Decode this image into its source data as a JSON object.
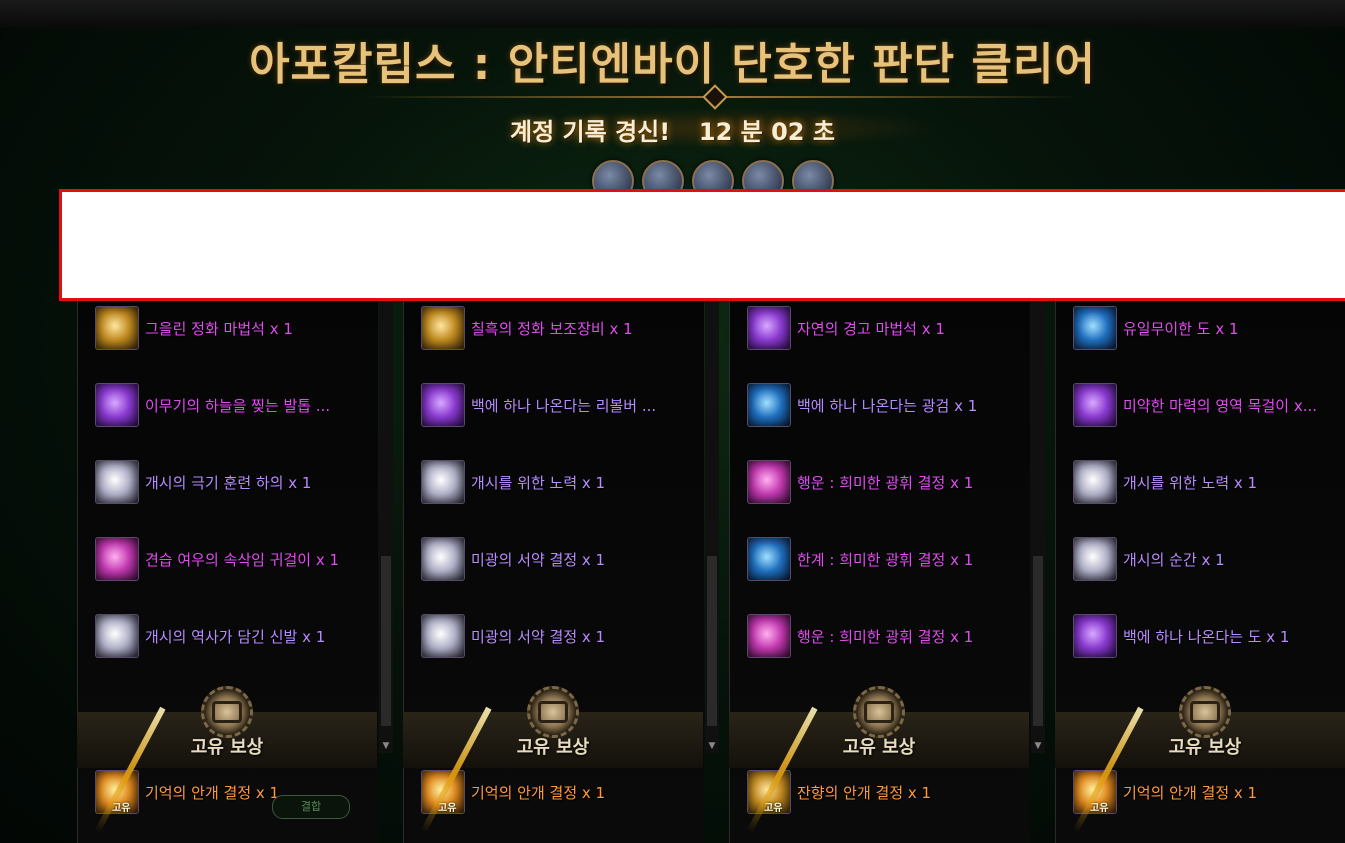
{
  "header": {
    "title": "아포칼립스 : 안티엔바이 단호한 판단 클리어",
    "record_text": "계정 기록 경신!",
    "time_text": "12 분 02 초"
  },
  "party_portrait_count": 5,
  "reward_label": "고유 보상",
  "reward_badge": "고유",
  "reward_button": "결합",
  "columns": [
    {
      "items": [
        {
          "name": "그을린 정화 마법석 x 1",
          "rarity": "epic",
          "icon": "gold"
        },
        {
          "name": "이무기의 하늘을 찢는 발톱 ...",
          "rarity": "epic",
          "icon": "purple"
        },
        {
          "name": "개시의 극기 훈련 하의 x 1",
          "rarity": "rare",
          "icon": "silver"
        },
        {
          "name": "견습 여우의 속삭임 귀걸이 x 1",
          "rarity": "epic",
          "icon": "pink"
        },
        {
          "name": "개시의 역사가 담긴 신발 x 1",
          "rarity": "rare",
          "icon": "silver"
        }
      ],
      "reward": {
        "name": "기억의 안개 결정 x 1",
        "icon": "orange"
      }
    },
    {
      "items": [
        {
          "name": "칠흑의 정화 보조장비 x 1",
          "rarity": "epic",
          "icon": "gold"
        },
        {
          "name": "백에 하나 나온다는 리볼버 ...",
          "rarity": "rare",
          "icon": "purple"
        },
        {
          "name": "개시를 위한 노력 x 1",
          "rarity": "rare",
          "icon": "silver"
        },
        {
          "name": "미광의 서약 결정 x 1",
          "rarity": "rare",
          "icon": "silver"
        },
        {
          "name": "미광의 서약 결정 x 1",
          "rarity": "rare",
          "icon": "silver"
        }
      ],
      "reward": {
        "name": "기억의 안개 결정 x 1",
        "icon": "orange"
      }
    },
    {
      "items": [
        {
          "name": "자연의 경고 마법석 x 1",
          "rarity": "epic",
          "icon": "purple"
        },
        {
          "name": "백에 하나 나온다는 광검 x 1",
          "rarity": "rare",
          "icon": "blue"
        },
        {
          "name": "행운 : 희미한 광휘 결정 x 1",
          "rarity": "epic",
          "icon": "pink"
        },
        {
          "name": "한계 : 희미한 광휘 결정 x 1",
          "rarity": "epic",
          "icon": "blue"
        },
        {
          "name": "행운 : 희미한 광휘 결정 x 1",
          "rarity": "epic",
          "icon": "pink"
        }
      ],
      "reward": {
        "name": "잔향의 안개 결정 x 1",
        "icon": "gold"
      }
    },
    {
      "items": [
        {
          "name": "유일무이한 도 x 1",
          "rarity": "epic",
          "icon": "blue"
        },
        {
          "name": "미약한 마력의 영역 목걸이 x...",
          "rarity": "epic",
          "icon": "purple"
        },
        {
          "name": "개시를 위한 노력 x 1",
          "rarity": "rare",
          "icon": "silver"
        },
        {
          "name": "개시의 순간 x 1",
          "rarity": "rare",
          "icon": "silver"
        },
        {
          "name": "백에 하나 나온다는 도 x 1",
          "rarity": "rare",
          "icon": "purple"
        }
      ],
      "reward": {
        "name": "기억의 안개 결정 x 1",
        "icon": "orange"
      }
    }
  ]
}
